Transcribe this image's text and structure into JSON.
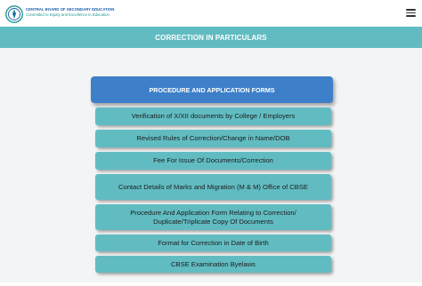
{
  "header": {
    "org_name_line1": "CENTRAL BOARD OF SECONDARY EDUCATION",
    "org_name_line2": "Committed to Equity and Excellence in Education",
    "logo_icon": "cbse-logo-icon",
    "menu_icon": "hamburger-menu-icon"
  },
  "page": {
    "title": "CORRECTION IN PARTICULARS"
  },
  "menu": {
    "section_label": "PROCEDURE AND APPLICATION FORMS",
    "items": [
      {
        "label": "Verification of X/XII documents by College / Employers"
      },
      {
        "label": "Revised Rules of Correction/Change in Name/DOB"
      },
      {
        "label": "Fee For Issue Of Documents/Correction"
      },
      {
        "label": "Contact Details of Marks and Migration (M & M) Office of CBSE"
      },
      {
        "label": "Procedure And Application Form Relating to Correction/ Duplicate/Triplicate Copy Of Documents"
      },
      {
        "label": "Format for Correction in Date of Birth"
      },
      {
        "label": "CBSE Examination Byelaws"
      }
    ]
  },
  "colors": {
    "teal": "#61bcc2",
    "blue": "#3d7fc9",
    "background": "#f3f4f5"
  }
}
